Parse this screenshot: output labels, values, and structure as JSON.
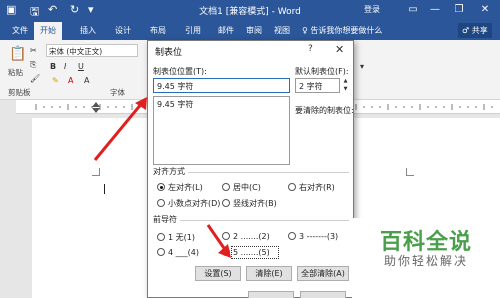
{
  "window": {
    "title": "文档1 [兼容模式] - Word",
    "login": "登录",
    "minimize": "—",
    "restore": "❐",
    "close": "✕"
  },
  "tabs": [
    "文件",
    "开始",
    "插入",
    "设计",
    "布局",
    "引用",
    "邮件",
    "审阅",
    "视图",
    "帮助"
  ],
  "tell_me": "♀ 告诉我你想要做什么",
  "share": "♂ 共享",
  "ribbon": {
    "font_name": "宋体 (中文正文)",
    "paste": "粘贴",
    "clipboard_group": "剪贴板",
    "font_group": "字体",
    "bold": "B",
    "italic": "I",
    "underline": "U"
  },
  "dialog": {
    "title": "制表位",
    "help": "?",
    "close": "✕",
    "tab_stop_label": "制表位位置(T):",
    "tab_stop_value": "9.45 字符",
    "tab_stop_list": [
      "9.45 字符"
    ],
    "default_label": "默认制表位(F):",
    "default_value": "2 字符",
    "clear_label": "要清除的制表位:",
    "alignment_label": "对齐方式",
    "alignment_options": {
      "left": "左对齐(L)",
      "center": "居中(C)",
      "right": "右对齐(R)",
      "decimal": "小数点对齐(D)",
      "bar": "竖线对齐(B)"
    },
    "leader_label": "前导符",
    "leader_options": {
      "l1": "1 无(1)",
      "l2": "2 .......(2)",
      "l3": "3 -------(3)",
      "l4": "4 ___(4)",
      "l5": "5 .......(5)"
    },
    "selected_alignment": "left",
    "selected_leader": "l5",
    "buttons": {
      "set": "设置(S)",
      "clear": "清除(E)",
      "clear_all": "全部清除(A)"
    }
  },
  "watermark": {
    "title": "百科全说",
    "subtitle": "助你轻松解决"
  },
  "colors": {
    "word_blue": "#2b579a",
    "arrow_red": "#e02020",
    "watermark_green": "#4a9f4a"
  }
}
